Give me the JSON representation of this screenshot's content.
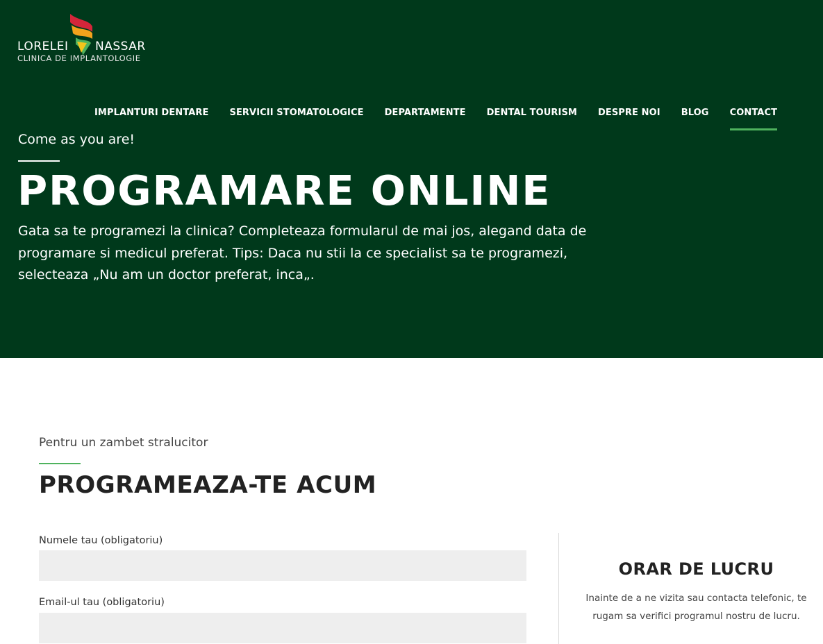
{
  "brand": {
    "name_left": "LORELEI",
    "name_right": "NASSAR",
    "subtitle": "CLINICA DE IMPLANTOLOGIE",
    "colors": {
      "red": "#d4263a",
      "orange": "#f3a21c",
      "green": "#4fb35e"
    }
  },
  "nav": {
    "items": [
      {
        "label": "IMPLANTURI DENTARE",
        "active": false
      },
      {
        "label": "SERVICII STOMATOLOGICE",
        "active": false
      },
      {
        "label": "DEPARTAMENTE",
        "active": false
      },
      {
        "label": "DENTAL TOURISM",
        "active": false
      },
      {
        "label": "DESPRE NOI",
        "active": false
      },
      {
        "label": "BLOG",
        "active": false
      },
      {
        "label": "CONTACT",
        "active": true
      }
    ]
  },
  "hero": {
    "tagline": "Come as you are!",
    "title": "PROGRAMARE ONLINE",
    "text": "Gata sa te programezi la clinica? Completeaza formularul de mai jos, alegand data de programare si medicul preferat. Tips: Daca nu stii la ce specialist sa te programezi, selecteaza „Nu am un doctor preferat, inca„.",
    "background": "#00391b"
  },
  "section": {
    "tagline": "Pentru un zambet stralucitor",
    "title": "PROGRAMEAZA-TE ACUM"
  },
  "form": {
    "name_label": "Numele tau (obligatoriu)",
    "name_value": "",
    "email_label": "Email-ul tau (obligatoriu)",
    "email_value": ""
  },
  "schedule": {
    "title": "ORAR DE LUCRU",
    "text": "Inainte de a ne vizita sau contacta telefonic, te rugam sa verifici programul nostru de lucru."
  }
}
